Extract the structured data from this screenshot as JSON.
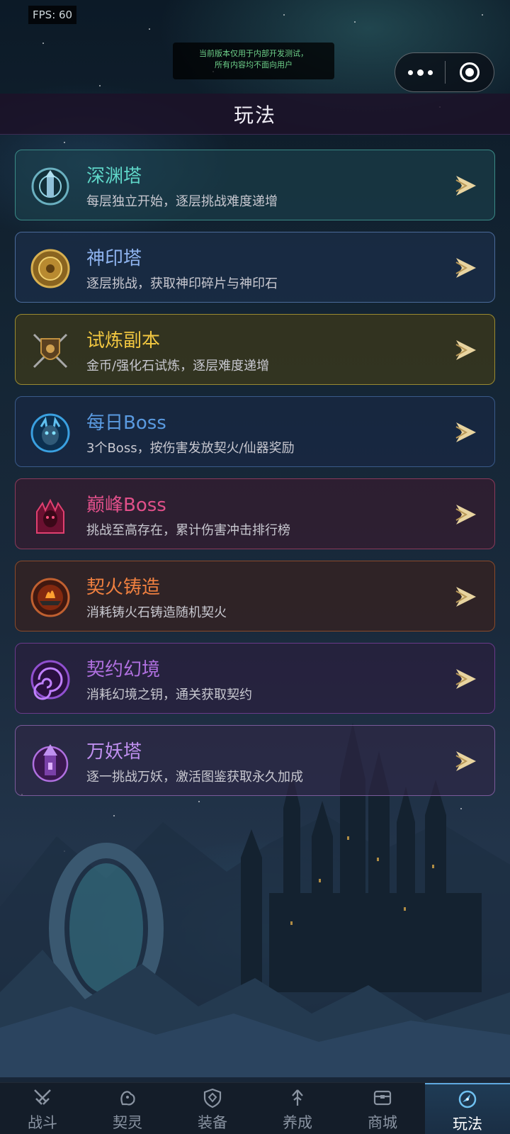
{
  "status": {
    "fps": "FPS: 60"
  },
  "notice": {
    "line1": "当前版本仅用于内部开发测试，",
    "line2": "所有内容均不面向用户"
  },
  "capsule": {
    "menu_icon": "more-dots-icon",
    "close_icon": "target-circle-icon"
  },
  "header": {
    "title": "玩法"
  },
  "modes": [
    {
      "title": "深渊塔",
      "desc": "每层独立开始，逐层挑战难度递增",
      "icon": "abyss-tower-emblem-icon",
      "title_color": "#5fd6c8",
      "border": "#3a8a86",
      "bg": "rgba(30,70,80,0.55)"
    },
    {
      "title": "神印塔",
      "desc": "逐层挑战，获取神印碎片与神印石",
      "icon": "golden-seal-medallion-icon",
      "title_color": "#8fb4f0",
      "border": "#4a6a9a",
      "bg": "rgba(30,50,80,0.55)"
    },
    {
      "title": "试炼副本",
      "desc": "金币/强化石试炼，逐层难度递增",
      "icon": "crossed-swords-shield-icon",
      "title_color": "#f0c640",
      "border": "#9a8a30",
      "bg": "rgba(70,62,20,0.6)"
    },
    {
      "title": "每日Boss",
      "desc": "3个Boss，按伤害发放契火/仙器奖励",
      "icon": "blue-demon-boss-icon",
      "title_color": "#5a9ae0",
      "border": "#3a5a8a",
      "bg": "rgba(25,40,70,0.6)"
    },
    {
      "title": "巅峰Boss",
      "desc": "挑战至高存在，累计伤害冲击排行榜",
      "icon": "crimson-demon-boss-icon",
      "title_color": "#e0508a",
      "border": "#8a3a5a",
      "bg": "rgba(60,25,45,0.6)"
    },
    {
      "title": "契火铸造",
      "desc": "消耗铸火石铸造随机契火",
      "icon": "forge-anvil-fire-icon",
      "title_color": "#f08040",
      "border": "#8a4a2a",
      "bg": "rgba(62,32,25,0.6)"
    },
    {
      "title": "契约幻境",
      "desc": "消耗幻境之钥，通关获取契约",
      "icon": "purple-vortex-portal-icon",
      "title_color": "#b070e0",
      "border": "#6a3a8a",
      "bg": "rgba(45,28,62,0.6)"
    },
    {
      "title": "万妖塔",
      "desc": "逐一挑战万妖，激活图鉴获取永久加成",
      "icon": "violet-crystal-tower-icon",
      "title_color": "#c090f0",
      "border": "#7a5a9a",
      "bg": "rgba(48,38,70,0.6)"
    }
  ],
  "tabs": [
    {
      "label": "战斗",
      "icon": "crossed-swords-icon",
      "active": false
    },
    {
      "label": "契灵",
      "icon": "spirit-beast-icon",
      "active": false
    },
    {
      "label": "装备",
      "icon": "shield-icon",
      "active": false
    },
    {
      "label": "养成",
      "icon": "upgrade-arrows-icon",
      "active": false
    },
    {
      "label": "商城",
      "icon": "shop-chest-icon",
      "active": false
    },
    {
      "label": "玩法",
      "icon": "compass-icon",
      "active": true
    }
  ]
}
